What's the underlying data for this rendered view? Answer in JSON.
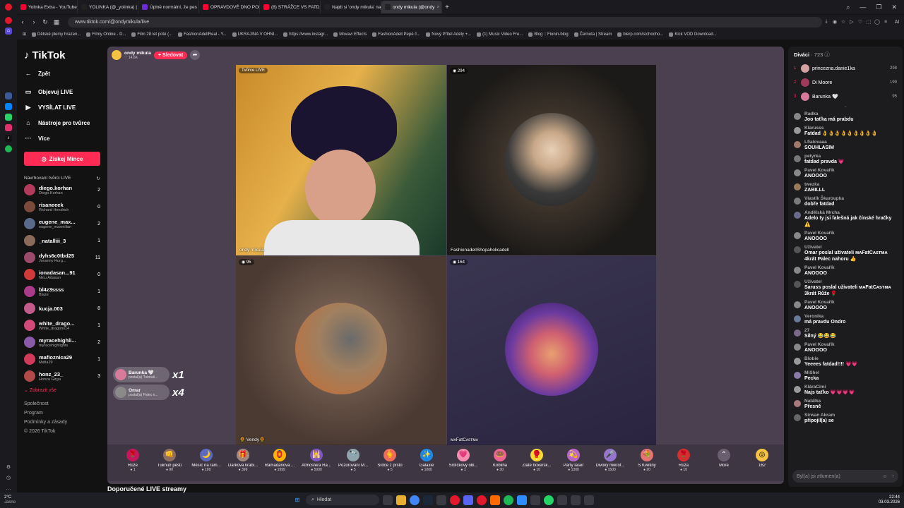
{
  "browser": {
    "tabs": [
      {
        "label": "Yolinka Extra - YouTube",
        "color": "#ff0033"
      },
      {
        "label": "YOLINKA (@_yolinka) | TikT",
        "color": "#222"
      },
      {
        "label": "Úplně normální, že pes m",
        "color": "#6b2bd9"
      },
      {
        "label": "OPRAVDOVÉ DNO POD D",
        "color": "#ff0033"
      },
      {
        "label": "(8) STRÁŽCE VS FATDAD",
        "color": "#ff0033"
      },
      {
        "label": "Najdi si 'ondy mikula' na",
        "color": "#222"
      },
      {
        "label": "ondy mikula (@ondy",
        "color": "#222",
        "active": true
      }
    ],
    "new_tab": "+",
    "url": "www.tiktok.com/@ondymikula/live",
    "bookmarks": [
      "Dětské plemy hrazen...",
      "Filmy Online - D...",
      "Film 28 let poté (...",
      "FashionAdellReal - Y...",
      "UKRAJINA V OHNI...",
      "https://www.instagr...",
      "Movavi Effects",
      "FashionAdell Pepé č...",
      "Nový Přítel Adély +...",
      "(1) Music Video Fre...",
      "Blog :: Fionin-blog",
      "Černota | Stream",
      "blerp.com/s/chocho...",
      "Kick VOD Download..."
    ]
  },
  "nav": {
    "logo": "TikTok",
    "back": "Zpět",
    "items": [
      {
        "icon": "▭",
        "label": "Objevuj LIVE"
      },
      {
        "icon": "▶",
        "label": "VYSÍLAT LIVE"
      },
      {
        "icon": "⌂",
        "label": "Nástroje pro tvůrce"
      },
      {
        "icon": "···",
        "label": "Více"
      }
    ],
    "coins_button": "Získej Mince",
    "recommended_title": "Navrhovaní tvůrci LIVE",
    "creators": [
      {
        "name": "diego.korhan",
        "sub": "Diego.Korhan",
        "viewers": "2",
        "color": "#b23a5a"
      },
      {
        "name": "risaneeek",
        "sub": "Richard Hendrich",
        "viewers": "0",
        "color": "#7a4b3b"
      },
      {
        "name": "eugene_max...",
        "sub": "eugene_maxmilian",
        "viewers": "2",
        "color": "#5a6a8a"
      },
      {
        "name": "_natalliii_3",
        "sub": "",
        "viewers": "1",
        "color": "#8a6b5a"
      },
      {
        "name": "dyhs6c0tbd25",
        "sub": "Jovanny Hurg...",
        "viewers": "11",
        "color": "#9a4a6a"
      },
      {
        "name": "ionadasan...91",
        "sub": "Nicu Adasan",
        "viewers": "0",
        "color": "#d13a3a"
      },
      {
        "name": "bl4z3ssss",
        "sub": "Blaze",
        "viewers": "1",
        "color": "#aa3a8a"
      },
      {
        "name": "kucja.003",
        "sub": "",
        "viewers": "8",
        "color": "#c25a8a"
      },
      {
        "name": "white_drago...",
        "sub": "White_dragons14",
        "viewers": "1",
        "color": "#d14a7a"
      },
      {
        "name": "myracehighli...",
        "sub": "myracehighlights",
        "viewers": "2",
        "color": "#8a5aaa"
      },
      {
        "name": "mafioznica29",
        "sub": "Mafia29",
        "viewers": "1",
        "color": "#d23a5a"
      },
      {
        "name": "honz_23_",
        "sub": "Honza Girga",
        "viewers": "3",
        "color": "#b34a4a"
      }
    ],
    "show_all": "Zobrazit vše",
    "footer": [
      "Společnost",
      "Program",
      "Podmínky a zásady",
      "© 2026 TikTok"
    ]
  },
  "stream": {
    "host_name": "ondy mikula",
    "host_likes": "14,6K",
    "follow_label": "+ Sledovat",
    "panels": [
      {
        "badge": "Tvůrce LIVE",
        "name": "ondy mikula"
      },
      {
        "badge": "294",
        "name": "FashionadellShopaholicadell"
      },
      {
        "badge": "95",
        "name": "Vendy"
      },
      {
        "badge": "164",
        "name": "ᴍᴀFatCᴀsᴛᴍᴀ"
      }
    ],
    "gift_alerts": [
      {
        "user": "Barunka 🤍",
        "text": "poslal(a) Ťuknutí...",
        "mult": "x1",
        "color": "#d87a9a"
      },
      {
        "user": "Omar",
        "text": "poslal(a) Palec n...",
        "mult": "x4",
        "color": "#8a8a8a"
      }
    ],
    "gifts": [
      {
        "name": "Růže",
        "price": "1",
        "icon": "🌹",
        "color": "#c2185b"
      },
      {
        "name": "Ťuknutí pěstí",
        "price": "90",
        "icon": "👊",
        "color": "#8d6e63"
      },
      {
        "name": "Měsíc na ram...",
        "price": "199",
        "icon": "🌙",
        "color": "#5c6bc0"
      },
      {
        "name": "Dárková krabi...",
        "price": "399",
        "icon": "🎁",
        "color": "#a1887f"
      },
      {
        "name": "Ramadánová ...",
        "price": "1999",
        "icon": "🏮",
        "color": "#ffb300"
      },
      {
        "name": "Atmosféra Ra...",
        "price": "5000",
        "icon": "🕌",
        "color": "#7e57c2"
      },
      {
        "name": "Pozorování M...",
        "price": "5",
        "icon": "🔭",
        "color": "#90a4ae"
      },
      {
        "name": "Srdce z prstů",
        "price": "5",
        "icon": "🫰",
        "color": "#ef6c5a"
      },
      {
        "name": "Galaxie",
        "price": "1000",
        "icon": "✨",
        "color": "#1e88e5"
      },
      {
        "name": "Srdíčkový obl...",
        "price": "1",
        "icon": "💗",
        "color": "#f48fb1"
      },
      {
        "name": "Kobliha",
        "price": "30",
        "icon": "🍩",
        "color": "#f06292"
      },
      {
        "name": "Zlaté boxersk...",
        "price": "10",
        "icon": "🥊",
        "color": "#fdd835"
      },
      {
        "name": "Párty laser",
        "price": "1300",
        "icon": "💫",
        "color": "#ba68c8"
      },
      {
        "name": "Divoký mikrof...",
        "price": "1500",
        "icon": "🎤",
        "color": "#9575cd"
      },
      {
        "name": "S Květiny",
        "price": "20",
        "icon": "💐",
        "color": "#e57373"
      },
      {
        "name": "Růža",
        "price": "10",
        "icon": "🌹",
        "color": "#d32f2f"
      }
    ],
    "more": "More",
    "coin_balance": "162"
  },
  "recommended_streams": "Doporučené LIVE streamy",
  "chat": {
    "viewers_label": "Diváci",
    "viewers_count": "· 723",
    "top": [
      {
        "rank": "1",
        "name": "princezna.danie1ka",
        "score": "298",
        "color": "#d4a0a0"
      },
      {
        "rank": "2",
        "name": "Di Moore",
        "score": "199",
        "color": "#a03a5a"
      },
      {
        "rank": "3",
        "name": "Barunka 🤍",
        "score": "95",
        "color": "#d87a9a"
      }
    ],
    "messages": [
      {
        "user": "Radka",
        "text": "Joo taťka má prabdu",
        "color": "#888"
      },
      {
        "user": "Klarusss",
        "text": "Fatdad 👌👌👌👌👌👌👌👌👌",
        "color": "#999"
      },
      {
        "user": "Lfialovaaa",
        "text": "SOUHLASIM",
        "color": "#a07a6a"
      },
      {
        "user": "petyrka",
        "text": "fatdad pravda 💗",
        "color": "#777"
      },
      {
        "user": "Pavel Kovařík",
        "text": "ANOOOO",
        "color": "#888"
      },
      {
        "user": "twezka",
        "text": "ZABILLL",
        "color": "#9a7a5a"
      },
      {
        "user": "Vlastík Škaroupka",
        "text": "dobře fatdad",
        "color": "#7a7a7a"
      },
      {
        "user": "Andělská Mrcha",
        "text": "Adelo ty jsi falešná jak čínské hračky ⚠️",
        "color": "#6a6a8a"
      },
      {
        "user": "Pavel Kovařík",
        "text": "ANOOOO",
        "color": "#888"
      },
      {
        "user": "Uživatel",
        "text": "Omar poslal uživateli ᴍᴀFatCᴀsᴛᴍᴀ 4krát Palec nahoru 👍",
        "color": "#555"
      },
      {
        "user": "Pavel Kovařík",
        "text": "ANOOOO",
        "color": "#888"
      },
      {
        "user": "Uživatel",
        "text": "Saruss poslal uživateli ᴍᴀFatCᴀsᴛᴍᴀ 3krát Růže 🌹",
        "color": "#555"
      },
      {
        "user": "Pavel Kovařík",
        "text": "ANOOOO",
        "color": "#888"
      },
      {
        "user": "Veronika",
        "text": "má pravdu Ondro",
        "color": "#6a7a9a"
      },
      {
        "user": "27",
        "text": "Silný 😂😂😂",
        "color": "#7a6a8a"
      },
      {
        "user": "Pavel Kovařík",
        "text": "ANOOOO",
        "color": "#888"
      },
      {
        "user": "Blobie",
        "text": "Yeeees fatdad!!!! 💗💗",
        "color": "#999"
      },
      {
        "user": "MiShel",
        "text": "Pecka",
        "color": "#8a7aaa"
      },
      {
        "user": "KláraCimi",
        "text": "Najs taťko 💗💗💗💗",
        "color": "#9a9a9a"
      },
      {
        "user": "Natálka",
        "text": "Přesně",
        "color": "#aa7a7a"
      },
      {
        "user": "Sirwan Akram",
        "text": "připojil(a) se",
        "color": "#666"
      }
    ],
    "input_placeholder": "Byl(a) jsi ztlumen(a)"
  },
  "taskbar": {
    "temp": "2°C",
    "weather": "Jasno",
    "search": "Hledat",
    "time": "22:44",
    "date": "03.03.2026"
  }
}
